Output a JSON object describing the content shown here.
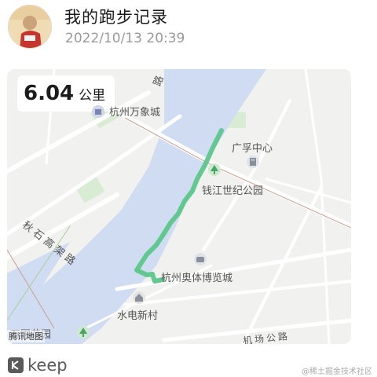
{
  "header": {
    "title": "我的跑步记录",
    "timestamp": "2022/10/13 20:39"
  },
  "run": {
    "distance_value": "6.04",
    "distance_unit": "公里",
    "route_color": "#5bc68a"
  },
  "map": {
    "labels": {
      "wanxiang": "杭州万象城",
      "guangyu": "广孚中心",
      "qianjiang_park": "钱江世纪公园",
      "olympic_expo": "杭州奥体博览城",
      "shuidian": "水电新村",
      "wanguo": "万国花园",
      "qiushi": "秋石高架路",
      "jichang": "机场公路",
      "lu_top": "路",
      "lu_left": "路"
    },
    "attribution": "腾讯地图",
    "colors": {
      "water": "#cfdcf2",
      "land": "#f1f1ef",
      "road": "#ffffff",
      "green": "#d7ecd2"
    }
  },
  "footer": {
    "logo_text": "keep",
    "watermark": "@稀土掘金技术社区"
  }
}
